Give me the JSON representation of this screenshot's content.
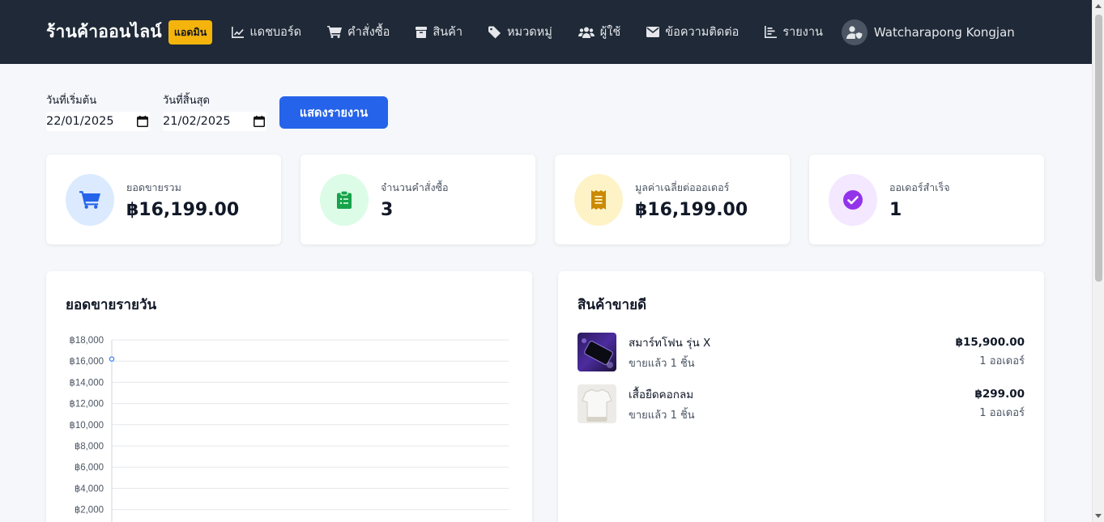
{
  "navbar": {
    "brand": "ร้านค้าออนไลน์",
    "badge": "แอดมิน",
    "items": [
      {
        "label": "แดชบอร์ด",
        "icon": "chart-line-icon"
      },
      {
        "label": "คำสั่งซื้อ",
        "icon": "cart-icon"
      },
      {
        "label": "สินค้า",
        "icon": "box-icon"
      },
      {
        "label": "หมวดหมู่",
        "icon": "tag-icon"
      },
      {
        "label": "ผู้ใช้",
        "icon": "users-icon"
      },
      {
        "label": "ข้อความติดต่อ",
        "icon": "envelope-icon"
      },
      {
        "label": "รายงาน",
        "icon": "report-icon"
      }
    ],
    "user": "Watcharapong Kongjan"
  },
  "filter": {
    "start_label": "วันที่เริ่มต้น",
    "start_value": "22/01/2025",
    "end_label": "วันที่สิ้นสุด",
    "end_value": "21/02/2025",
    "button": "แสดงรายงาน"
  },
  "stats": [
    {
      "label": "ยอดขายรวม",
      "value": "฿16,199.00",
      "icon": "cart-icon",
      "bg": "#dbeafe",
      "color": "#2563eb"
    },
    {
      "label": "จำนวนคำสั่งซื้อ",
      "value": "3",
      "icon": "clipboard-icon",
      "bg": "#dcfce7",
      "color": "#16a34a"
    },
    {
      "label": "มูลค่าเฉลี่ยต่อออเดอร์",
      "value": "฿16,199.00",
      "icon": "receipt-icon",
      "bg": "#fef3c7",
      "color": "#ca8a04"
    },
    {
      "label": "ออเดอร์สำเร็จ",
      "value": "1",
      "icon": "check-circle-icon",
      "bg": "#f3e8ff",
      "color": "#9333ea"
    }
  ],
  "daily_sales": {
    "title": "ยอดขายรายวัน"
  },
  "chart_data": {
    "type": "line",
    "title": "ยอดขายรายวัน",
    "y_ticks": [
      "฿18,000",
      "฿16,000",
      "฿14,000",
      "฿12,000",
      "฿10,000",
      "฿8,000",
      "฿6,000",
      "฿4,000",
      "฿2,000"
    ],
    "ylim": [
      0,
      18000
    ],
    "series": [
      {
        "values": [
          16199
        ]
      }
    ],
    "grid": true,
    "color": "#3b82f6"
  },
  "best_sellers": {
    "title": "สินค้าขายดี",
    "items": [
      {
        "name": "สมาร์ทโฟน รุ่น X",
        "sold": "ขายแล้ว 1 ชิ้น",
        "price": "฿15,900.00",
        "orders": "1 ออเดอร์"
      },
      {
        "name": "เสื้อยืดคอกลม",
        "sold": "ขายแล้ว 1 ชิ้น",
        "price": "฿299.00",
        "orders": "1 ออเดอร์"
      }
    ]
  }
}
